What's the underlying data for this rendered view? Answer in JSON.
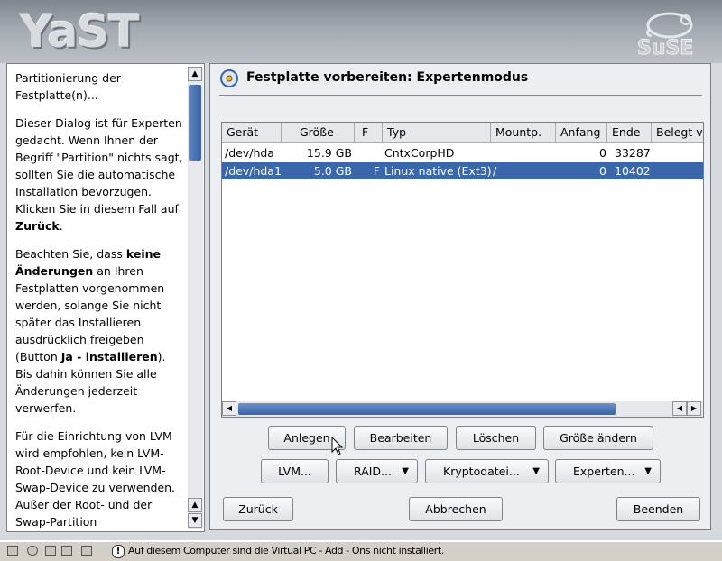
{
  "header": {
    "logo_text": "YaST",
    "brand": "SuSE"
  },
  "help": {
    "p1": "Partitionierung der Festplatte(n)...",
    "p2a": "Dieser Dialog ist für Experten gedacht. Wenn Ihnen der Begriff \"Partition\" nichts sagt, sollten Sie die automatische Installation bevorzugen. Klicken Sie in diesem Fall auf ",
    "p2b": "Zurück",
    "p2c": ".",
    "p3a": "Beachten Sie, dass ",
    "p3b": "keine Änderungen",
    "p3c": " an Ihren Festplatten vorgenommen werden, solange Sie nicht später das Installieren ausdrücklich freigeben (Button ",
    "p3d": "Ja - installieren",
    "p3e": "). Bis dahin können Sie alle Änderungen jederzeit verwerfen.",
    "p4": "Für die Einrichtung von LVM wird empfohlen, kein LVM-Root-Device und kein LVM-Swap-Device zu verwenden. Außer der Root- und der Swap-Partition"
  },
  "panel": {
    "title": "Festplatte vorbereiten: Expertenmodus",
    "columns": [
      "Gerät",
      "Größe",
      "F",
      "Typ",
      "Mountp.",
      "Anfang",
      "Ende",
      "Belegt v"
    ],
    "rows": [
      {
        "device": "/dev/hda",
        "size": "15.9 GB",
        "flag": "",
        "type": "CntxCorpHD",
        "mount": "",
        "start": "0",
        "end": "33287",
        "selected": false
      },
      {
        "device": "/dev/hda1",
        "size": "5.0 GB",
        "flag": "F",
        "type": "Linux native (Ext3)",
        "mount": "/",
        "start": "0",
        "end": "10402",
        "selected": true
      }
    ],
    "buttons": {
      "create": "Anlegen",
      "edit": "Bearbeiten",
      "delete": "Löschen",
      "resize": "Größe ändern",
      "lvm": "LVM...",
      "raid": "RAID...",
      "crypt": "Kryptodatei...",
      "expert": "Experten..."
    },
    "nav": {
      "back": "Zurück",
      "abort": "Abbrechen",
      "finish": "Beenden"
    }
  },
  "status": {
    "text": "Auf diesem Computer sind die Virtual PC - Add - Ons nicht installiert."
  }
}
